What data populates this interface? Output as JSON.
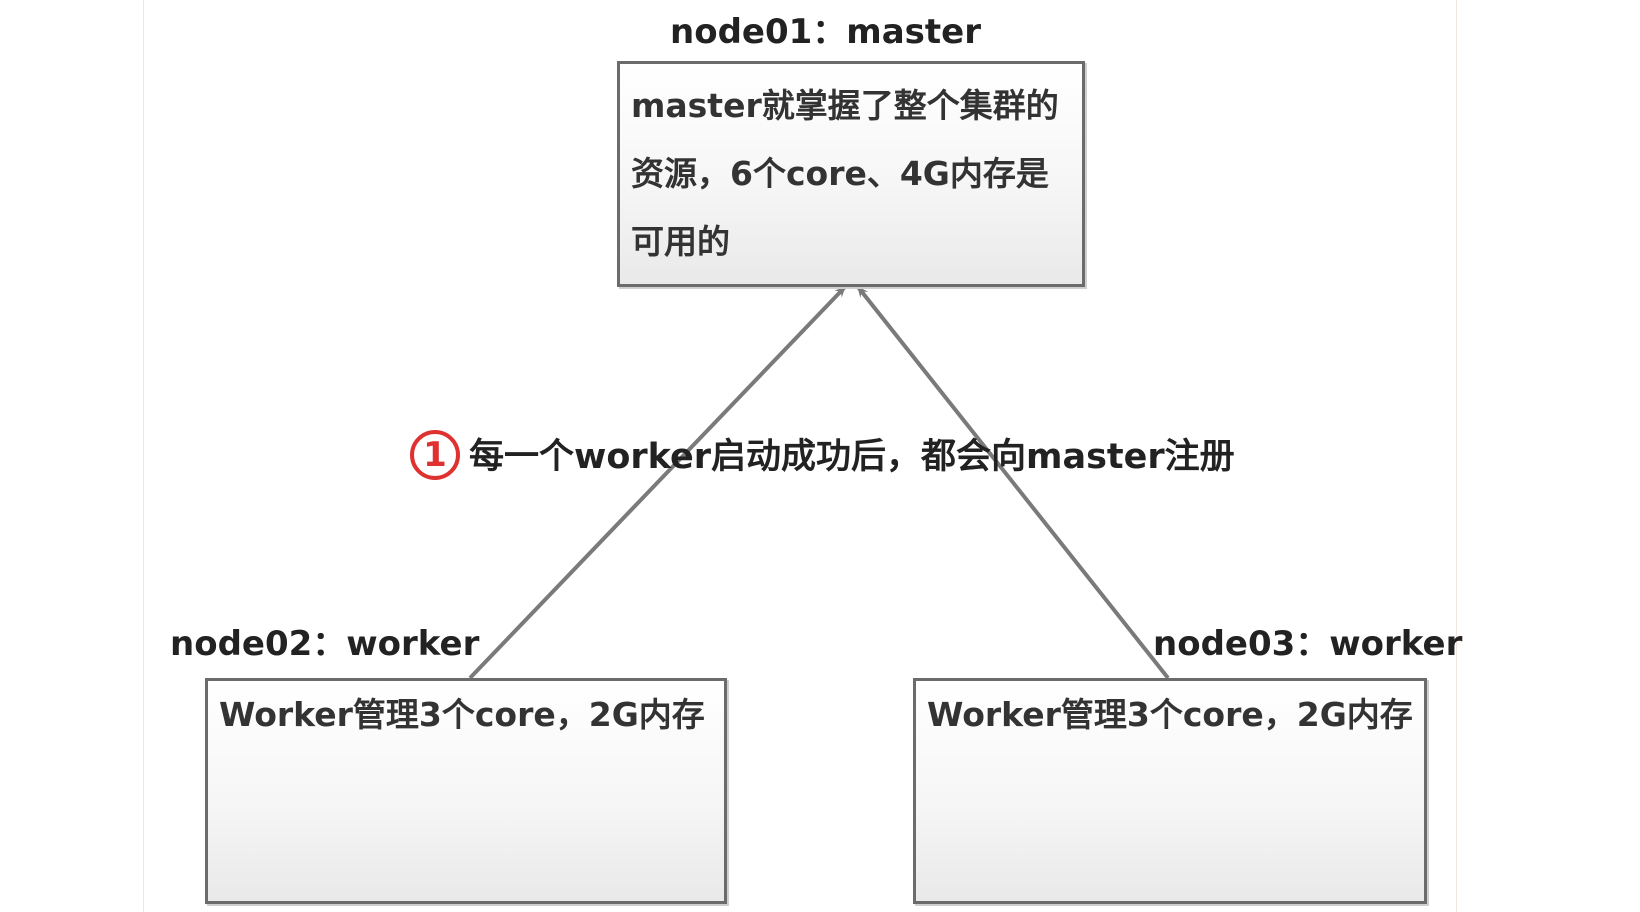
{
  "colors": {
    "arrow": "#7a7a7a",
    "box_border": "#6b6b6b",
    "badge": "#e03131",
    "text": "#222222"
  },
  "nodes": {
    "master": {
      "title": "node01：master",
      "text": "master就掌握了整个集群的资源，6个core、4G内存是可用的"
    },
    "worker1": {
      "title": "node02：worker",
      "text": "Worker管理3个core，2G内存"
    },
    "worker2": {
      "title": "node03：worker",
      "text": "Worker管理3个core，2G内存"
    }
  },
  "annotation": {
    "step_number": "1",
    "text": "每一个worker启动成功后，都会向master注册"
  }
}
